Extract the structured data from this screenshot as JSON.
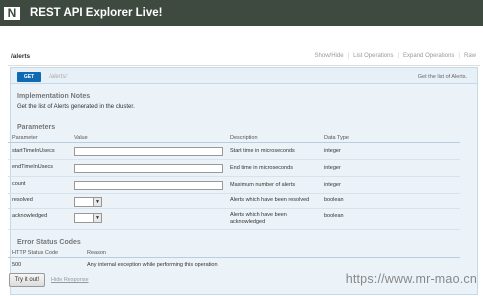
{
  "app": {
    "title": "REST API Explorer Live!",
    "logo_glyph": "N"
  },
  "resource": {
    "name": "/alerts",
    "links": [
      "Show/Hide",
      "List Operations",
      "Expand Operations",
      "Raw"
    ]
  },
  "operation": {
    "verb": "GET",
    "path": "/alerts/",
    "summary": "Get the list of Alerts."
  },
  "implementation_notes": {
    "heading": "Implementation Notes",
    "text": "Get the list of Alerts generated in the cluster."
  },
  "parameters": {
    "heading": "Parameters",
    "columns": [
      "Parameter",
      "Value",
      "Description",
      "Data Type"
    ],
    "rows": [
      {
        "name": "startTimeInUsecs",
        "input": "text",
        "value": "",
        "description": "Start time in microseconds",
        "type": "integer"
      },
      {
        "name": "endTimeInUsecs",
        "input": "text",
        "value": "",
        "description": "End time in microseconds",
        "type": "integer"
      },
      {
        "name": "count",
        "input": "text",
        "value": "",
        "description": "Maximum number of alerts",
        "type": "integer"
      },
      {
        "name": "resolved",
        "input": "select",
        "value": "",
        "description": "Alerts which have been resolved",
        "type": "boolean"
      },
      {
        "name": "acknowledged",
        "input": "select",
        "value": "",
        "description": "Alerts which have been acknowledged",
        "type": "boolean"
      }
    ]
  },
  "error_codes": {
    "heading": "Error Status Codes",
    "columns": [
      "HTTP Status Code",
      "Reason"
    ],
    "rows": [
      {
        "code": "500",
        "reason": "Any internal exception while performing this operation"
      }
    ]
  },
  "actions": {
    "try_label": "Try it out!",
    "hide_response_label": "Hide Response"
  },
  "watermark": "https://www.mr-mao.cn",
  "colors": {
    "topbar": "#3e4a3f",
    "verb_get": "#0f6ab4",
    "operation_bg": "#ebf3f9"
  }
}
